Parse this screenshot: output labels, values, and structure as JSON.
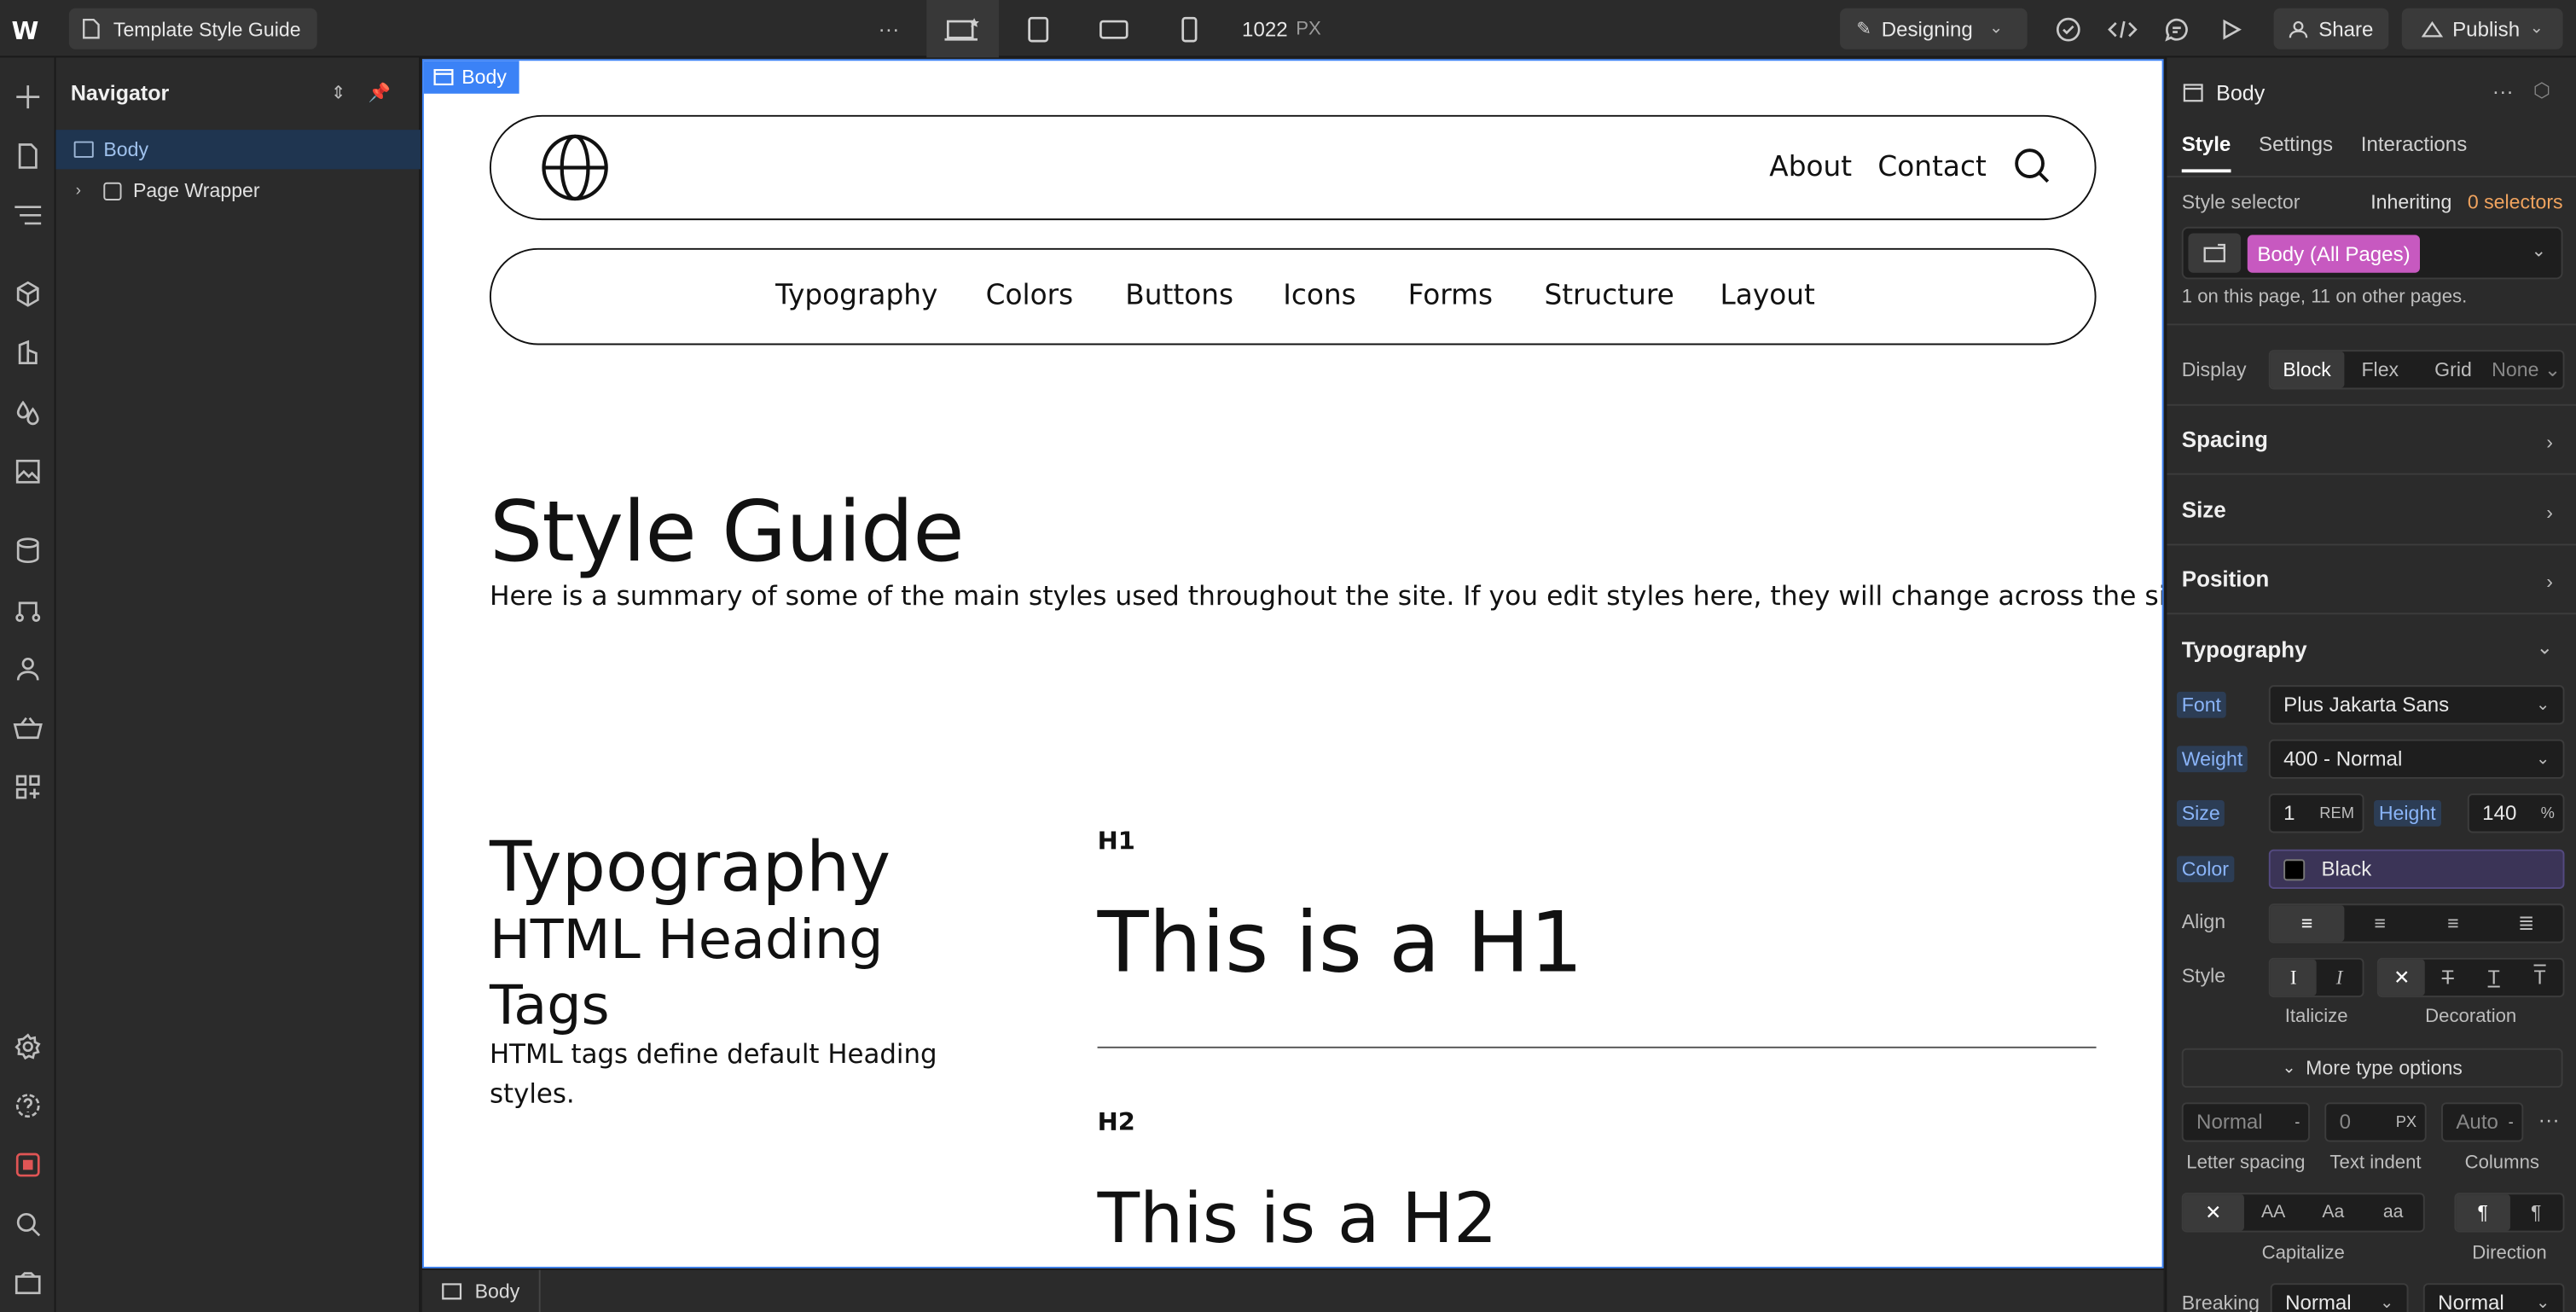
{
  "topbar": {
    "page_name": "Template Style Guide",
    "width_value": "1022",
    "width_unit": "PX",
    "mode": "Designing",
    "share": "Share",
    "publish": "Publish"
  },
  "navigator": {
    "title": "Navigator",
    "items": [
      {
        "label": "Body"
      },
      {
        "label": "Page Wrapper"
      }
    ]
  },
  "canvas": {
    "body_tag": "Body",
    "header_links": [
      "About",
      "Contact"
    ],
    "subnav": [
      "Typography",
      "Colors",
      "Buttons",
      "Icons",
      "Forms",
      "Structure",
      "Layout"
    ],
    "title": "Style Guide",
    "subtitle": "Here is a summary of some of the main styles used throughout the site. If you edit styles here, they will change across the site.",
    "typo_title": "Typography",
    "typo_sub": "HTML Heading Tags",
    "typo_desc": "HTML tags define default Heading styles.",
    "h1_label": "H1",
    "h1_demo": "This is a H1",
    "h2_label": "H2",
    "h2_demo": "This is a H2"
  },
  "breadcrumb": {
    "item": "Body"
  },
  "panel": {
    "element": "Body",
    "tabs": [
      "Style",
      "Settings",
      "Interactions"
    ],
    "selector_label": "Style selector",
    "inheriting_prefix": "Inheriting",
    "inheriting_count": "0 selectors",
    "selector_tag": "Body (All Pages)",
    "usage": "1 on this page, 11 on other pages.",
    "display_label": "Display",
    "display_options": [
      "Block",
      "Flex",
      "Grid",
      "None"
    ],
    "sections": [
      "Spacing",
      "Size",
      "Position",
      "Typography"
    ],
    "font_label": "Font",
    "font_value": "Plus Jakarta Sans",
    "weight_label": "Weight",
    "weight_value": "400 - Normal",
    "size_label": "Size",
    "size_value": "1",
    "size_unit": "REM",
    "height_label": "Height",
    "height_value": "140",
    "height_unit": "%",
    "color_label": "Color",
    "color_value": "Black",
    "align_label": "Align",
    "style_label": "Style",
    "italicize_label": "Italicize",
    "decoration_label": "Decoration",
    "more_type_options": "More type options",
    "letter_spacing_value": "Normal",
    "text_indent_value": "0",
    "text_indent_unit": "PX",
    "columns_value": "Auto",
    "letter_spacing_label": "Letter spacing",
    "text_indent_label": "Text indent",
    "columns_label": "Columns",
    "case_options": [
      "AA",
      "Aa",
      "aa"
    ],
    "capitalize_label": "Capitalize",
    "direction_label": "Direction",
    "breaking_label": "Breaking",
    "breaking_value_1": "Normal",
    "breaking_value_2": "Normal"
  },
  "colors": {
    "accent": "#3b82f6",
    "selector_tag": "#c759c0",
    "inherit_count": "#f0a35e"
  }
}
